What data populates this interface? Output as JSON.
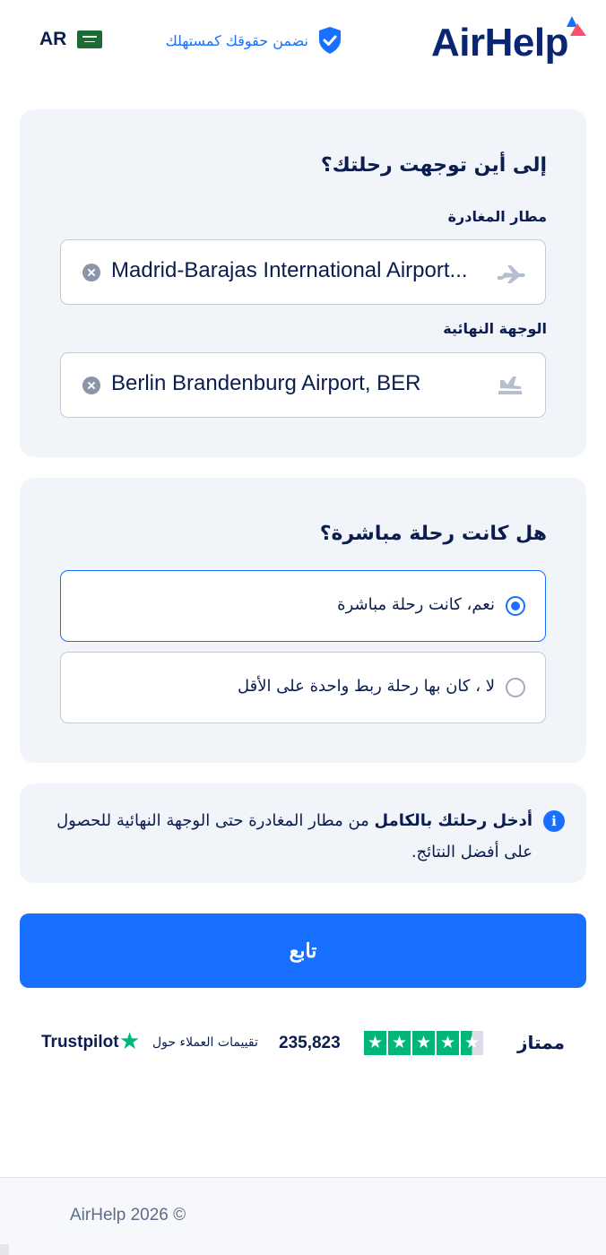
{
  "header": {
    "logo_text": "AirHelp",
    "guarantee_text": "نضمن حقوقك كمستهلك",
    "language_code": "AR"
  },
  "route_card": {
    "title": "إلى أين توجهت رحلتك؟",
    "departure_label": "مطار المغادرة",
    "departure_value": "Madrid-Barajas International Airport...",
    "destination_label": "الوجهة النهائية",
    "destination_value": "Berlin Brandenburg Airport, BER"
  },
  "direct_card": {
    "title": "هل كانت رحلة مباشرة؟",
    "options": [
      {
        "label": "نعم، كانت رحلة مباشرة",
        "selected": true
      },
      {
        "label": "لا ، كان بها رحلة ربط واحدة على الأقل",
        "selected": false
      }
    ]
  },
  "info": {
    "bold": "أدخل رحلتك بالكامل",
    "text": " من مطار المغادرة حتى الوجهة النهائية للحصول على أفضل النتائج."
  },
  "continue_label": "تابع",
  "trustpilot": {
    "rating_word": "ممتاز",
    "stars": 4.5,
    "review_count": "235,823",
    "reviews_text": "تقييمات العملاء حول",
    "brand": "Trustpilot"
  },
  "footer": {
    "copyright": "AirHelp 2026 ©"
  },
  "colors": {
    "brand_blue": "#1770ff",
    "navy": "#0a2672",
    "trustpilot_green": "#00b67a",
    "card_bg": "#f1f4f9"
  },
  "icons": {
    "shield": "shield-check-icon",
    "plane_departure": "airplane-takeoff-icon",
    "plane_arrival": "airplane-landing-icon",
    "clear": "clear-circle-icon",
    "info": "info-icon",
    "star": "star-icon"
  }
}
